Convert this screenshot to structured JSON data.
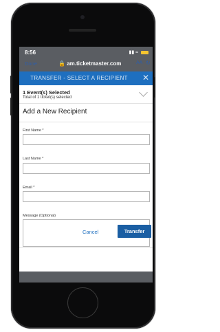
{
  "status": {
    "time": "8:56"
  },
  "browser": {
    "done_label": "Done",
    "url": "am.ticketmaster.com",
    "text_size_label": "AA"
  },
  "modal": {
    "title": "TRANSFER - SELECT A RECIPIENT",
    "event_summary": "1 Event(s) Selected",
    "ticket_summary": "Total of 1 ticket(s) selected",
    "section_title": "Add a New Recipient",
    "fields": [
      {
        "label": "First Name *",
        "value": ""
      },
      {
        "label": "Last Name *",
        "value": ""
      },
      {
        "label": "Email *",
        "value": ""
      }
    ],
    "message": {
      "label": "Message (Optional)",
      "value": ""
    },
    "cancel_label": "Cancel",
    "transfer_label": "Transfer"
  },
  "colors": {
    "header_blue": "#1e6fbf",
    "button_blue": "#1a5ea3",
    "safari_blue": "#2f5ea8"
  },
  "icons": [
    "lock-icon",
    "close-icon",
    "chevron-down-icon",
    "back-icon",
    "forward-icon",
    "share-icon",
    "compass-icon"
  ]
}
